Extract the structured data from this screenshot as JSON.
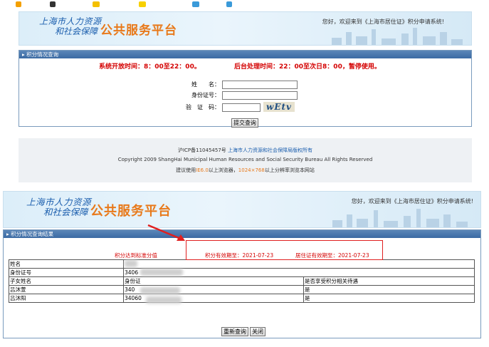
{
  "banner": {
    "logo_line1": "上海市人力资源",
    "logo_line2": "和社会保障",
    "platform": "公共服务平台",
    "welcome_top": "您好，欢迎来到《上海市居住证》积分申请系统!",
    "welcome_bottom": "您好，欢迎来到《上海市居住证》积分申请系统!"
  },
  "query_panel": {
    "header": "积分情况查询",
    "open_hours": "系统开放时间：8：00至22：00。",
    "maintenance_hours": "后台处理时间：22：00至次日8：00，暂停使用。",
    "name_label": "姓　　名：",
    "id_label": "身份证号：",
    "captcha_label": "验　证　码：",
    "captcha_text": "wEtv",
    "submit_label": "提交查询"
  },
  "footer": {
    "icp": "沪ICP备11045457号",
    "rights_cn": "上海市人力资源和社会保障局版权所有",
    "copyright": "Copyright 2009 ShangHai Municipal Human Resources and Social Security Bureau All Rights Reserved",
    "browser_prefix": "建议使用",
    "browser_ie": "IE6.0",
    "browser_mid": "以上浏览器，",
    "browser_res": "1024×768",
    "browser_suffix": "以上分辨率浏览本网站"
  },
  "result_panel": {
    "header": "积分情况查询结果",
    "status": "积分达到标准分值",
    "points_valid": "积分有效期至：2021-07-23",
    "permit_valid": "居住证有效期至：2021-07-23",
    "row_name": "姓名",
    "row_id": "身份证号",
    "id_partial": "3406",
    "col_child": "子女姓名",
    "col_id": "身份证",
    "col_benefit": "是否享受积分相关待遇",
    "children": [
      {
        "name": "吕沐萱",
        "id": "340",
        "benefit": "是"
      },
      {
        "name": "吕沐阳",
        "id": "34060",
        "benefit": "是"
      }
    ],
    "requery_label": "重新查询",
    "close_label": "关闭"
  },
  "colors": {
    "accent_blue": "#1c5fae",
    "orange": "#e8791a",
    "red": "#d40000",
    "header_blue": "#3b6aa3"
  }
}
